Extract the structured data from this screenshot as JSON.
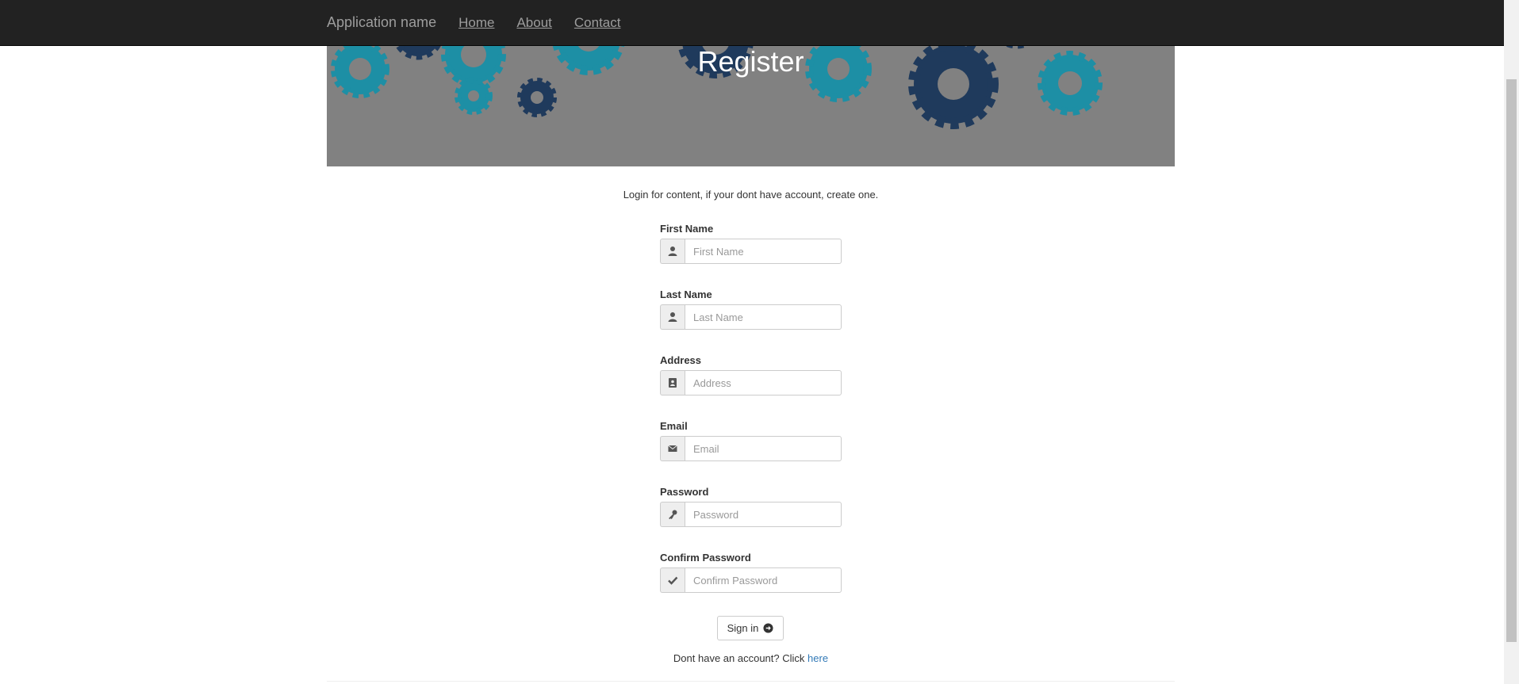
{
  "navbar": {
    "brand": "Application name",
    "links": [
      "Home",
      "About",
      "Contact"
    ]
  },
  "banner": {
    "title": "Register"
  },
  "intro": "Login for content, if your dont have account, create one.",
  "form": {
    "fields": [
      {
        "label": "First Name",
        "placeholder": "First Name",
        "icon": "user-icon"
      },
      {
        "label": "Last Name",
        "placeholder": "Last Name",
        "icon": "user-icon"
      },
      {
        "label": "Address",
        "placeholder": "Address",
        "icon": "address-card-icon"
      },
      {
        "label": "Email",
        "placeholder": "Email",
        "icon": "envelope-icon"
      },
      {
        "label": "Password",
        "placeholder": "Password",
        "icon": "key-icon"
      },
      {
        "label": "Confirm Password",
        "placeholder": "Confirm Password",
        "icon": "check-icon"
      }
    ],
    "submit_label": "Sign in"
  },
  "footer": {
    "text": "Dont have an account? Click",
    "link": "here"
  },
  "colors": {
    "navbar_bg": "#222222",
    "banner_bg": "#818181",
    "gear_teal": "#1d8fa5",
    "gear_navy": "#1f3a5c",
    "link": "#337ab7"
  }
}
